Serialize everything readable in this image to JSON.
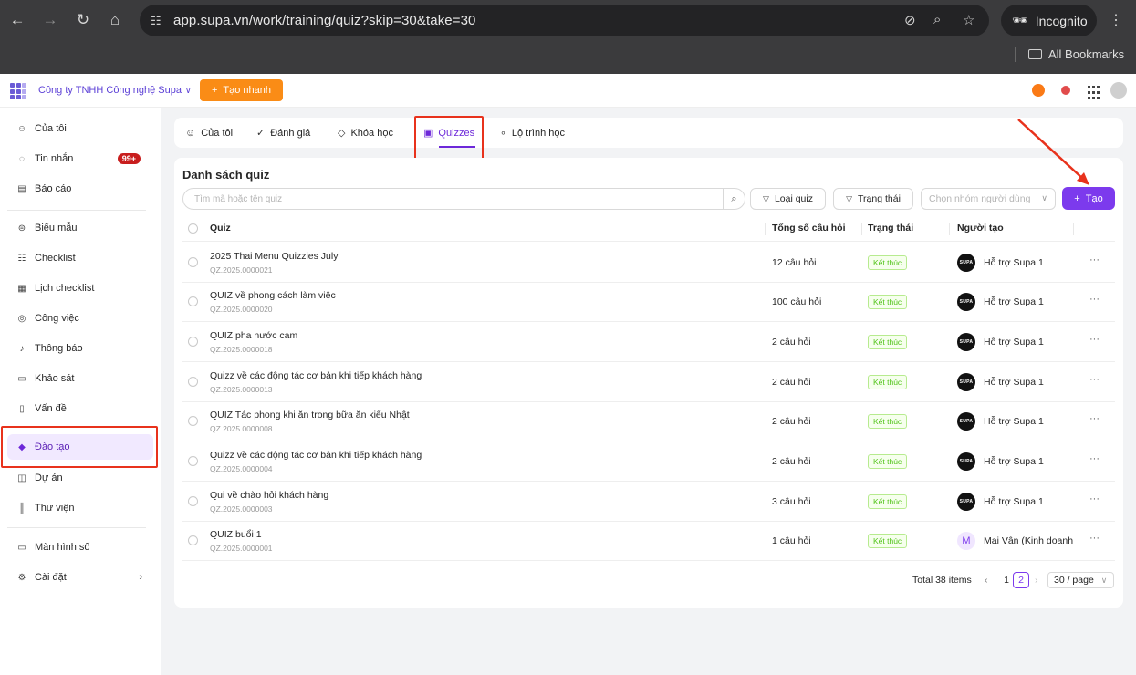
{
  "browser": {
    "url": "app.supa.vn/work/training/quiz?skip=30&take=30",
    "profile_label": "Incognito",
    "bookmarks_label": "All Bookmarks"
  },
  "header": {
    "company": "Công ty TNHH Công nghệ Supa",
    "quick_create": "Tạo nhanh"
  },
  "sidebar": {
    "items": [
      {
        "label": "Của tôi",
        "icon": "user-icon"
      },
      {
        "label": "Tin nhắn",
        "icon": "chat-icon",
        "badge": "99+"
      },
      {
        "label": "Báo cáo",
        "icon": "report-icon"
      },
      {
        "label": "Biểu mẫu",
        "icon": "form-icon"
      },
      {
        "label": "Checklist",
        "icon": "checklist-icon"
      },
      {
        "label": "Lịch checklist",
        "icon": "calendar-icon"
      },
      {
        "label": "Công việc",
        "icon": "task-icon"
      },
      {
        "label": "Thông báo",
        "icon": "bell-icon"
      },
      {
        "label": "Khảo sát",
        "icon": "survey-icon"
      },
      {
        "label": "Vấn đề",
        "icon": "issue-icon"
      },
      {
        "label": "Đào tạo",
        "icon": "training-icon"
      },
      {
        "label": "Dự án",
        "icon": "project-icon"
      },
      {
        "label": "Thư viện",
        "icon": "library-icon"
      },
      {
        "label": "Màn hình số",
        "icon": "monitor-icon"
      },
      {
        "label": "Cài đặt",
        "icon": "gear-icon"
      }
    ]
  },
  "tabs": [
    {
      "label": "Của tôi",
      "icon": "user-icon"
    },
    {
      "label": "Đánh giá",
      "icon": "check-icon"
    },
    {
      "label": "Khóa học",
      "icon": "graduation-cap-icon"
    },
    {
      "label": "Quizzes",
      "icon": "quiz-icon"
    },
    {
      "label": "Lộ trình học",
      "icon": "route-icon"
    }
  ],
  "main": {
    "title": "Danh sách quiz",
    "search_placeholder": "Tìm mã hoặc tên quiz",
    "filter_type": "Loại quiz",
    "filter_status": "Trạng thái",
    "group_placeholder": "Chọn nhóm người dùng",
    "create_label": "Tạo"
  },
  "table": {
    "columns": [
      "Quiz",
      "Tổng số câu hỏi",
      "Trạng thái",
      "Người tạo"
    ],
    "rows": [
      {
        "name": "2025 Thai Menu Quizzies July",
        "code": "QZ.2025.0000021",
        "count": "12 câu hỏi",
        "status": "Kết thúc",
        "creator": "Hỗ trợ Supa 1",
        "avatar": "SUPA"
      },
      {
        "name": "QUIZ về phong cách làm việc",
        "code": "QZ.2025.0000020",
        "count": "100 câu hỏi",
        "status": "Kết thúc",
        "creator": "Hỗ trợ Supa 1",
        "avatar": "SUPA"
      },
      {
        "name": "QUIZ pha nước cam",
        "code": "QZ.2025.0000018",
        "count": "2 câu hỏi",
        "status": "Kết thúc",
        "creator": "Hỗ trợ Supa 1",
        "avatar": "SUPA"
      },
      {
        "name": "Quizz về các động tác cơ bản khi tiếp khách hàng",
        "code": "QZ.2025.0000013",
        "count": "2 câu hỏi",
        "status": "Kết thúc",
        "creator": "Hỗ trợ Supa 1",
        "avatar": "SUPA"
      },
      {
        "name": "QUIZ Tác phong khi ăn trong bữa ăn kiểu Nhật",
        "code": "QZ.2025.0000008",
        "count": "2 câu hỏi",
        "status": "Kết thúc",
        "creator": "Hỗ trợ Supa 1",
        "avatar": "SUPA"
      },
      {
        "name": "Quizz về các động tác cơ bản khi tiếp khách hàng",
        "code": "QZ.2025.0000004",
        "count": "2 câu hỏi",
        "status": "Kết thúc",
        "creator": "Hỗ trợ Supa 1",
        "avatar": "SUPA"
      },
      {
        "name": "Qui về chào hỏi khách hàng",
        "code": "QZ.2025.0000003",
        "count": "3 câu hỏi",
        "status": "Kết thúc",
        "creator": "Hỗ trợ Supa 1",
        "avatar": "SUPA"
      },
      {
        "name": "QUIZ buổi 1",
        "code": "QZ.2025.0000001",
        "count": "1 câu hỏi",
        "status": "Kết thúc",
        "creator": "Mai Vân (Kinh doanh",
        "avatar": "M"
      }
    ]
  },
  "pagination": {
    "total": "Total 38 items",
    "pages": [
      "1",
      "2"
    ],
    "current_page": "2",
    "page_size": "30 / page"
  },
  "colors": {
    "accent": "#7c3aed",
    "quick_create": "#fa8c16",
    "status_done": "#52c41a",
    "annotation": "#e8321c"
  }
}
